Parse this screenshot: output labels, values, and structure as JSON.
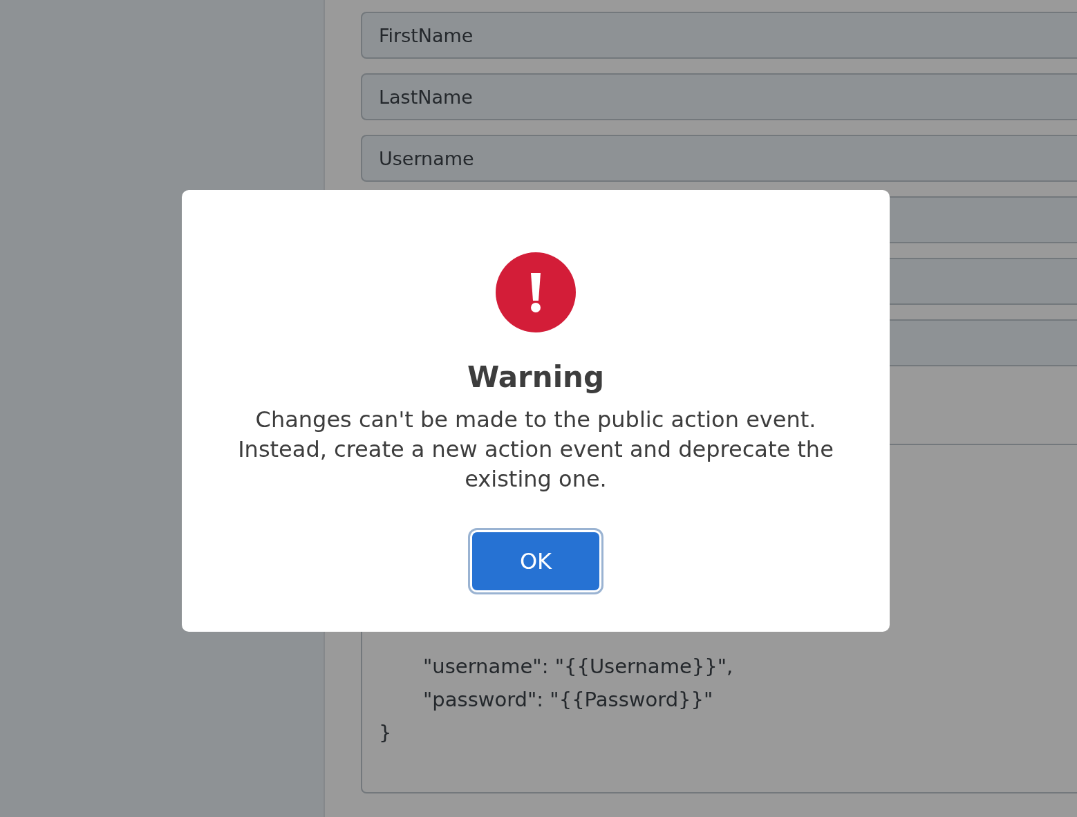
{
  "form": {
    "fields": [
      {
        "kind": "text",
        "value": "FirstName"
      },
      {
        "kind": "text",
        "value": "LastName"
      },
      {
        "kind": "text",
        "value": "Username"
      },
      {
        "kind": "blank"
      },
      {
        "kind": "blank"
      },
      {
        "kind": "blank"
      }
    ],
    "code_lines": [
      {
        "text": "\"username\": \"{{Username}}\",",
        "indented": true
      },
      {
        "text": "\"password\": \"{{Password}}\"",
        "indented": true
      },
      {
        "text": "}",
        "indented": false
      }
    ]
  },
  "dialog": {
    "title": "Warning",
    "message": "Changes can't be made to the public action event. Instead, create a new action event and deprecate the existing one.",
    "buttons": [
      "OK"
    ]
  }
}
